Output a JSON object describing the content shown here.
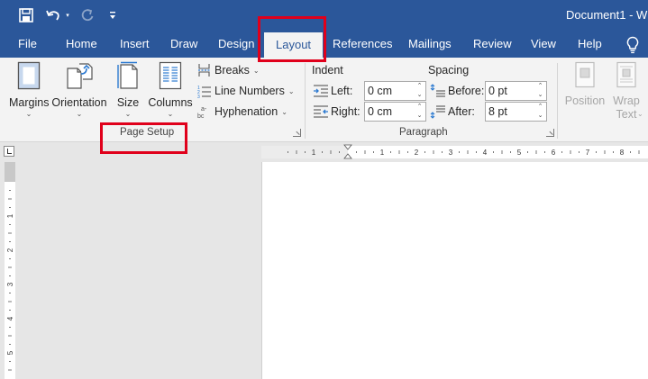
{
  "window": {
    "doc_title": "Document1 - W"
  },
  "quick_access": {
    "save_icon": "save-icon",
    "undo_icon": "undo-icon",
    "redo_icon": "redo-icon",
    "customize_icon": "customize-qat-icon"
  },
  "tabs": [
    {
      "label": "File"
    },
    {
      "label": "Home"
    },
    {
      "label": "Insert"
    },
    {
      "label": "Draw"
    },
    {
      "label": "Design"
    },
    {
      "label": "Layout",
      "active": true
    },
    {
      "label": "References"
    },
    {
      "label": "Mailings"
    },
    {
      "label": "Review"
    },
    {
      "label": "View"
    },
    {
      "label": "Help"
    }
  ],
  "page_setup": {
    "group_label": "Page Setup",
    "margins": "Margins",
    "orientation": "Orientation",
    "size": "Size",
    "columns": "Columns",
    "breaks": "Breaks",
    "line_numbers": "Line Numbers",
    "hyphenation": "Hyphenation"
  },
  "paragraph": {
    "group_label": "Paragraph",
    "indent_title": "Indent",
    "spacing_title": "Spacing",
    "left_label": "Left:",
    "left_value": "0 cm",
    "right_label": "Right:",
    "right_value": "0 cm",
    "before_label": "Before:",
    "before_value": "0 pt",
    "after_label": "After:",
    "after_value": "8 pt"
  },
  "arrange": {
    "position": "Position",
    "wrap_line1": "Wrap",
    "wrap_line2": "Text"
  },
  "ruler": {
    "h_numbers": [
      "1",
      "1",
      "2",
      "3",
      "4",
      "5",
      "6",
      "7",
      "8"
    ],
    "v_numbers": [
      "1",
      "2",
      "3",
      "4",
      "5"
    ]
  },
  "colors": {
    "accent": "#2b579a",
    "highlight": "#e0001b",
    "ribbon": "#f3f3f3",
    "workspace": "#e6e6e6"
  }
}
